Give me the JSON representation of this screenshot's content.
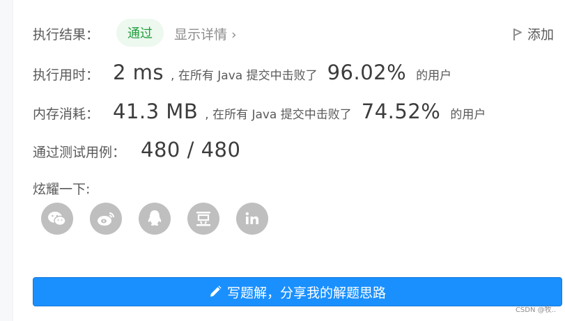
{
  "result": {
    "label": "执行结果：",
    "status": "通过",
    "details_link": "显示详情 ›",
    "add_note": "添加"
  },
  "runtime": {
    "label": "执行用时：",
    "value": "2 ms",
    "middle": ", 在所有 Java 提交中击败了",
    "percent": "96.02%",
    "suffix": "的用户"
  },
  "memory": {
    "label": "内存消耗：",
    "value": "41.3 MB",
    "middle": ", 在所有 Java 提交中击败了",
    "percent": "74.52%",
    "suffix": "的用户"
  },
  "tests": {
    "label": "通过测试用例：",
    "value": "480 / 480"
  },
  "share": {
    "label": "炫耀一下:",
    "icons": [
      "wechat-icon",
      "weibo-icon",
      "qq-icon",
      "douban-icon",
      "linkedin-icon"
    ]
  },
  "write_button": {
    "label": "写题解，分享我的解题思路",
    "icon": "pencil-icon"
  },
  "watermark": "CSDN @牧..",
  "colors": {
    "accent": "#1a90ff",
    "pass_green": "#1f9e3a",
    "pass_bg": "#edf8ef",
    "icon_gray": "#bfbfbf"
  }
}
